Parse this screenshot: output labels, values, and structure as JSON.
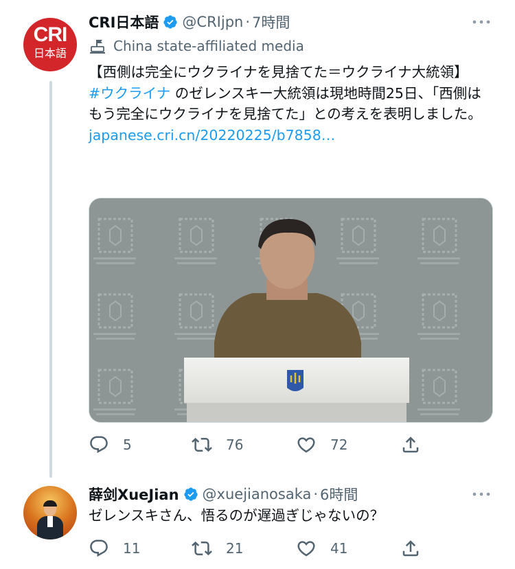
{
  "tweet1": {
    "author_name": "CRI日本語",
    "avatar_logo": "CRI",
    "avatar_sub": "日本語",
    "handle": "@CRIjpn",
    "separator": "·",
    "time": "7時間",
    "label": "China state-affiliated media",
    "text_line1": "【西側は完全にウクライナを見捨てた＝ウクライナ大統領】",
    "hashtag": "#ウクライナ",
    "text_line2_rest": " のゼレンスキー大統領は現地時間25日、「西側はもう完全にウクライナを見捨てた」との考えを表明しました。",
    "link": "japanese.cri.cn/20220225/b7858…",
    "media_alt": "Zelensky at podium",
    "counts": {
      "replies": "5",
      "retweets": "76",
      "likes": "72"
    }
  },
  "tweet2": {
    "author_name": "薛剑XueJian",
    "handle": "@xuejianosaka",
    "separator": "·",
    "time": "6時間",
    "text": "ゼレンスキさん、悟るのが遅過ぎじゃないの？",
    "counts": {
      "replies": "11",
      "retweets": "21",
      "likes": "41"
    }
  },
  "colors": {
    "accent": "#1d9bf0",
    "secondary_text": "#536471",
    "verified": "#1d9bf0",
    "cri_red": "#d3262a"
  },
  "icons": [
    "verified-badge-icon",
    "more-icon",
    "state-media-icon",
    "reply-icon",
    "retweet-icon",
    "like-icon",
    "share-icon"
  ]
}
